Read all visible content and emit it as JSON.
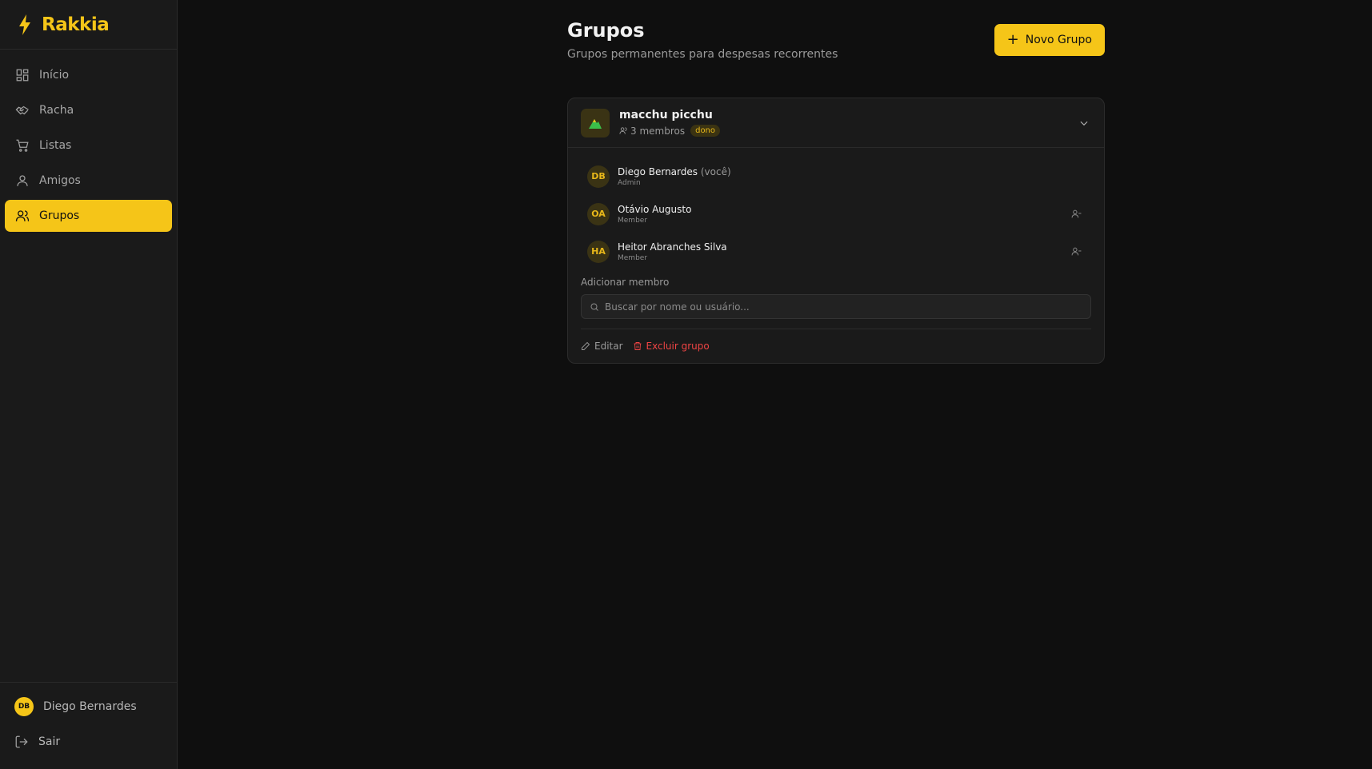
{
  "app": {
    "name": "Rakkia",
    "accent": "#f5c518",
    "danger": "#ef4444"
  },
  "sidebar": {
    "items": [
      {
        "label": "Início",
        "icon": "grid-icon",
        "active": false
      },
      {
        "label": "Racha",
        "icon": "handshake-icon",
        "active": false
      },
      {
        "label": "Listas",
        "icon": "cart-icon",
        "active": false
      },
      {
        "label": "Amigos",
        "icon": "user-icon",
        "active": false
      },
      {
        "label": "Grupos",
        "icon": "users-icon",
        "active": true
      }
    ],
    "user": {
      "initials": "DB",
      "name": "Diego Bernardes"
    },
    "logout_label": "Sair"
  },
  "page": {
    "title": "Grupos",
    "subtitle": "Grupos permanentes para despesas recorrentes",
    "new_button_label": "Novo Grupo"
  },
  "group": {
    "name": "macchu picchu",
    "member_count_label": "3 membros",
    "badge": "dono",
    "members": [
      {
        "initials": "DB",
        "name": "Diego Bernardes",
        "you": "(você)",
        "role": "Admin"
      },
      {
        "initials": "OA",
        "name": "Otávio Augusto",
        "you": "",
        "role": "Member"
      },
      {
        "initials": "HA",
        "name": "Heitor Abranches Silva",
        "you": "",
        "role": "Member"
      }
    ],
    "add_member_label": "Adicionar membro",
    "search_placeholder": "Buscar por nome ou usuário...",
    "edit_label": "Editar",
    "delete_label": "Excluir grupo"
  }
}
